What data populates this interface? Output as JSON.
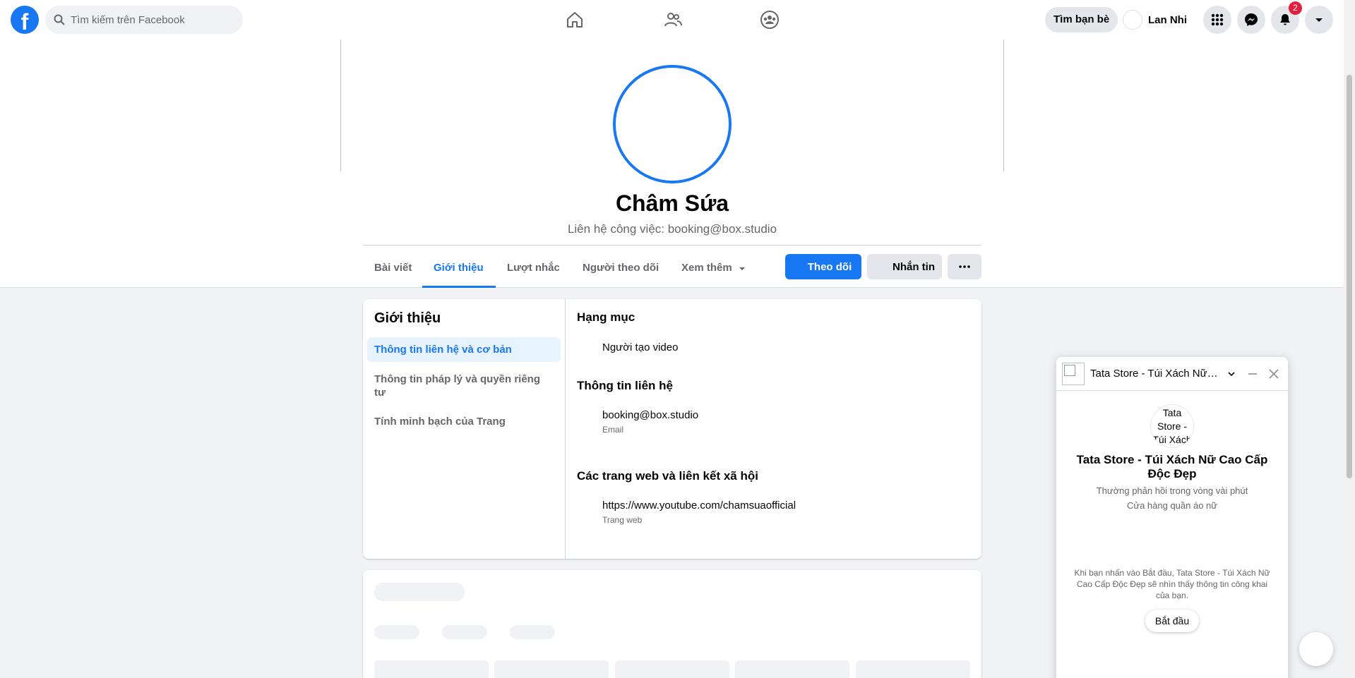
{
  "topbar": {
    "logo": "f",
    "search_placeholder": "Tìm kiếm trên Facebook",
    "find_friends_label": "Tìm bạn bè",
    "user_name": "Lan Nhi",
    "notification_count": "2",
    "icons": [
      "home-icon",
      "friends-icon",
      "groups-icon",
      "menu-grid-icon",
      "messenger-icon",
      "bell-icon",
      "account-caret-icon"
    ]
  },
  "profile": {
    "name": "Châm Sứa",
    "subtitle": "Liên hệ công việc: booking@box.studio",
    "tabs": [
      {
        "label": "Bài viết",
        "active": false
      },
      {
        "label": "Giới thiệu",
        "active": true
      },
      {
        "label": "Lượt nhắc",
        "active": false
      },
      {
        "label": "Người theo dõi",
        "active": false
      },
      {
        "label": "Xem thêm",
        "active": false
      }
    ],
    "follow_label": "Theo dõi",
    "message_label": "Nhắn tin",
    "more_label": "···"
  },
  "about": {
    "title": "Giới thiệu",
    "sidebar": [
      {
        "label": "Thông tin liên hệ và cơ bản",
        "active": true
      },
      {
        "label": "Thông tin pháp lý và quyền riêng tư",
        "active": false
      },
      {
        "label": "Tính minh bạch của Trang",
        "active": false
      }
    ],
    "category_title": "Hạng mục",
    "category_value": "Người tạo video",
    "contact_title": "Thông tin liên hệ",
    "email_value": "booking@box.studio",
    "email_caption": "Email",
    "links_title": "Các trang web và liên kết xã hội",
    "website_value": "https://www.youtube.com/chamsuaofficial",
    "website_caption": "Trang web"
  },
  "chat": {
    "header_name": "Tata Store - Túi Xách Nữ Cao Cấp Độc Đẹp",
    "avatar_alt": "Tata Store - Túi Xách",
    "title": "Tata Store - Túi Xách Nữ Cao Cấp Độc Đẹp",
    "response_time": "Thường phản hồi trong vòng vài phút",
    "category": "Cửa hàng quần áo nữ",
    "note": "Khi bạn nhấn vào Bắt đầu, Tata Store - Túi Xách Nữ Cao Cấp Độc Đẹp sẽ nhìn thấy thông tin công khai của bạn.",
    "start_label": "Bắt đầu"
  },
  "colors": {
    "accent": "#1877f2",
    "badge": "#e41e3f",
    "background": "#f0f2f5"
  }
}
